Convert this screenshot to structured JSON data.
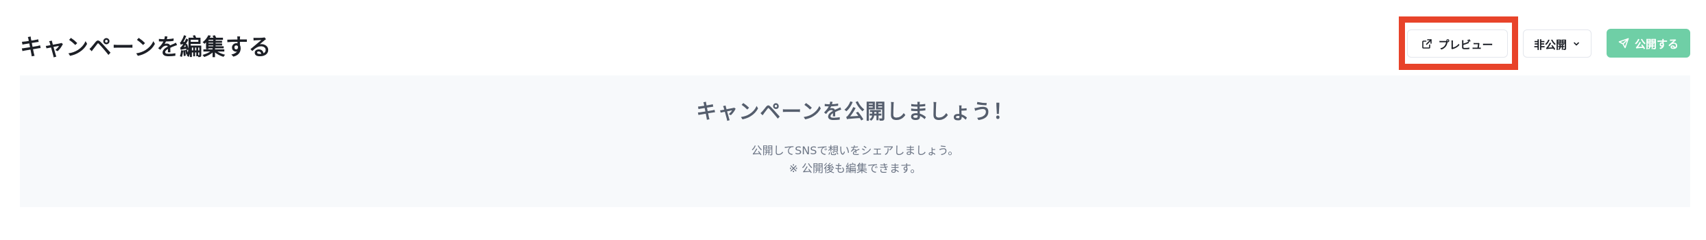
{
  "header": {
    "title": "キャンペーンを編集する"
  },
  "toolbar": {
    "preview_label": "プレビュー",
    "preview_icon": "external-link-icon",
    "visibility_label": "非公開",
    "visibility_icon": "chevron-down-icon",
    "publish_label": "公開する",
    "publish_icon": "send-icon",
    "highlight_color": "#e8432a",
    "publish_color": "#6fcfa6"
  },
  "panel": {
    "heading": "キャンペーンを公開しましょう！",
    "line1": "公開してSNSで想いをシェアしましょう。",
    "line2": "※ 公開後も編集できます。"
  }
}
